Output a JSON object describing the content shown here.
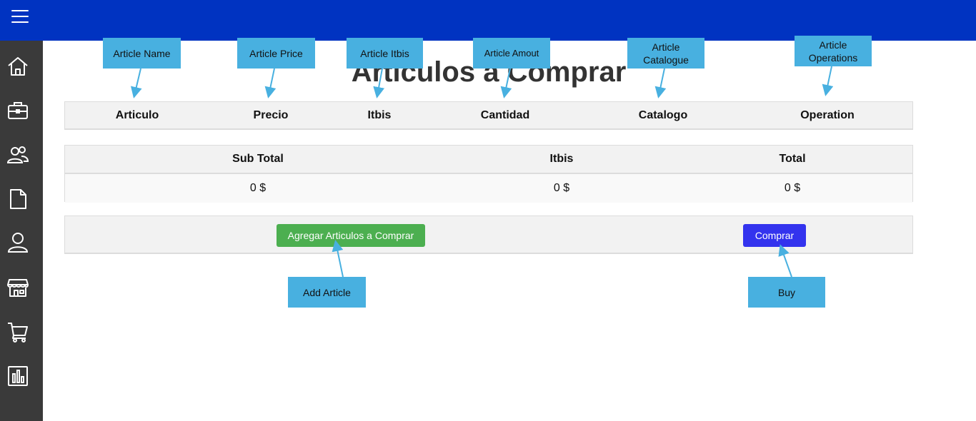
{
  "page": {
    "title": "Articulos a Comprar"
  },
  "sidebar": {
    "items": [
      {
        "name": "home-icon"
      },
      {
        "name": "briefcase-icon"
      },
      {
        "name": "users-icon"
      },
      {
        "name": "document-icon"
      },
      {
        "name": "user-icon"
      },
      {
        "name": "store-icon"
      },
      {
        "name": "cart-icon"
      },
      {
        "name": "chart-icon"
      }
    ]
  },
  "table": {
    "columns": [
      "Articulo",
      "Precio",
      "Itbis",
      "Cantidad",
      "Catalogo",
      "Operation"
    ],
    "rows": []
  },
  "totals": {
    "headers": [
      "Sub Total",
      "Itbis",
      "Total"
    ],
    "values": [
      "0 $",
      "0 $",
      "0 $"
    ]
  },
  "actions": {
    "add_label": "Agregar Articulos a Comprar",
    "buy_label": "Comprar"
  },
  "annotations": {
    "article_name": "Article Name",
    "article_price": "Article Price",
    "article_itbis": "Article Itbis",
    "article_amount": "Article Amout",
    "article_catalogue": "Article Catalogue",
    "article_operations": "Article Operations",
    "add_article": "Add Article",
    "buy": "Buy"
  },
  "colors": {
    "topbar": "#0033c1",
    "sidebar": "#3a3a3a",
    "add_button": "#4caf50",
    "buy_button": "#3333ee",
    "annotation": "#48b0e0"
  }
}
